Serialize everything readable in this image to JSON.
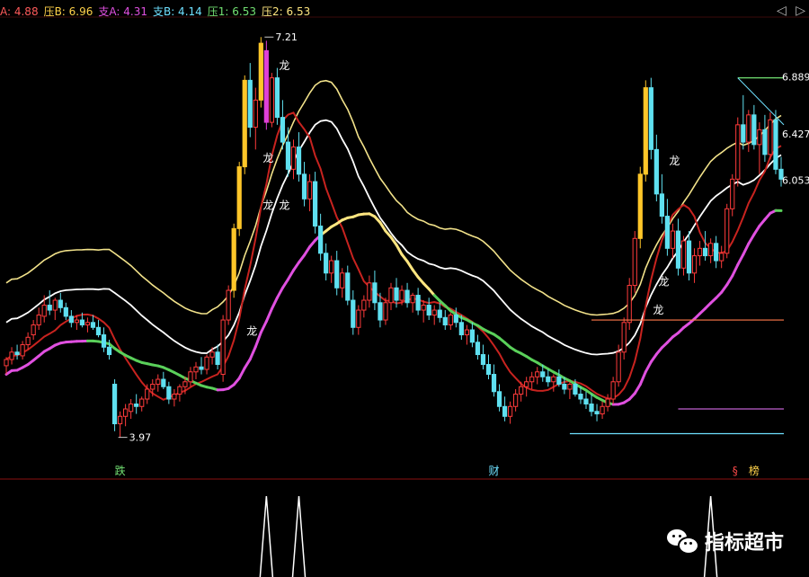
{
  "legend": [
    {
      "label": "A: 4.88",
      "color": "#ff5a5a"
    },
    {
      "label": "压B: 6.96",
      "color": "#ffd24a"
    },
    {
      "label": "支A: 4.31",
      "color": "#e050e0"
    },
    {
      "label": "支B: 4.14",
      "color": "#6ee0ff"
    },
    {
      "label": "压1: 6.53",
      "color": "#72e072"
    },
    {
      "label": "压2: 6.53",
      "color": "#ffe680"
    }
  ],
  "nav": {
    "prev": "◁",
    "next": "▷"
  },
  "watermark": {
    "text": "指标超市"
  },
  "chart_data": {
    "type": "candlestick",
    "y_range": [
      3.8,
      7.35
    ],
    "price_labels": [
      {
        "text": "7.21",
        "value": 7.21,
        "index": 48
      },
      {
        "text": "3.97",
        "value": 3.97,
        "index": 21
      },
      {
        "text": "6.889",
        "value": 6.889,
        "axis": true
      },
      {
        "text": "6.427",
        "value": 6.427,
        "axis": true
      },
      {
        "text": "6.053",
        "value": 6.053,
        "axis": true
      }
    ],
    "signal_labels": [
      {
        "text": "龙",
        "index": 50,
        "value": 6.95
      },
      {
        "text": "龙",
        "index": 47,
        "value": 6.2
      },
      {
        "text": "龙",
        "index": 47,
        "value": 5.82
      },
      {
        "text": "龙",
        "index": 50,
        "value": 5.82
      },
      {
        "text": "龙",
        "index": 44,
        "value": 4.8
      },
      {
        "text": "龙",
        "index": 122,
        "value": 6.18
      },
      {
        "text": "龙",
        "index": 120,
        "value": 5.2
      },
      {
        "text": "龙",
        "index": 119,
        "value": 4.97
      }
    ],
    "bottom_labels": [
      {
        "text": "跌",
        "index": 21,
        "color": "#72e072"
      },
      {
        "text": "财",
        "index": 90,
        "color": "#6ee0ff"
      },
      {
        "text": "§",
        "index": 135,
        "color": "#ff4a4a"
      },
      {
        "text": "榜",
        "index": 138,
        "color": "#ffd24a"
      }
    ],
    "candles": [
      [
        4.55,
        4.62,
        4.48,
        4.6
      ],
      [
        4.6,
        4.7,
        4.56,
        4.66
      ],
      [
        4.66,
        4.72,
        4.6,
        4.64
      ],
      [
        4.63,
        4.75,
        4.6,
        4.72
      ],
      [
        4.72,
        4.82,
        4.68,
        4.78
      ],
      [
        4.8,
        4.92,
        4.76,
        4.88
      ],
      [
        4.88,
        5.02,
        4.84,
        4.96
      ],
      [
        4.95,
        5.12,
        4.9,
        5.04
      ],
      [
        5.04,
        5.16,
        4.96,
        5.0
      ],
      [
        5.0,
        5.1,
        4.92,
        5.08
      ],
      [
        5.08,
        5.14,
        4.98,
        5.02
      ],
      [
        5.02,
        5.06,
        4.92,
        4.95
      ],
      [
        4.95,
        5.0,
        4.86,
        4.9
      ],
      [
        4.9,
        4.96,
        4.84,
        4.92
      ],
      [
        4.92,
        4.98,
        4.86,
        4.88
      ],
      [
        4.88,
        4.94,
        4.82,
        4.9
      ],
      [
        4.9,
        4.96,
        4.84,
        4.86
      ],
      [
        4.86,
        4.92,
        4.78,
        4.8
      ],
      [
        4.8,
        4.86,
        4.66,
        4.7
      ],
      [
        4.7,
        4.76,
        4.6,
        4.64
      ],
      [
        4.4,
        4.44,
        4.02,
        4.08
      ],
      [
        4.08,
        4.18,
        3.97,
        4.14
      ],
      [
        4.14,
        4.24,
        4.06,
        4.2
      ],
      [
        4.18,
        4.28,
        4.12,
        4.24
      ],
      [
        4.24,
        4.32,
        4.16,
        4.22
      ],
      [
        4.22,
        4.3,
        4.18,
        4.28
      ],
      [
        4.28,
        4.4,
        4.24,
        4.36
      ],
      [
        4.36,
        4.44,
        4.3,
        4.4
      ],
      [
        4.4,
        4.48,
        4.34,
        4.44
      ],
      [
        4.44,
        4.5,
        4.36,
        4.38
      ],
      [
        4.38,
        4.42,
        4.24,
        4.28
      ],
      [
        4.28,
        4.36,
        4.22,
        4.32
      ],
      [
        4.32,
        4.4,
        4.26,
        4.38
      ],
      [
        4.38,
        4.46,
        4.32,
        4.42
      ],
      [
        4.42,
        4.54,
        4.38,
        4.5
      ],
      [
        4.5,
        4.58,
        4.44,
        4.54
      ],
      [
        4.54,
        4.62,
        4.48,
        4.52
      ],
      [
        4.52,
        4.64,
        4.48,
        4.62
      ],
      [
        4.62,
        4.7,
        4.56,
        4.66
      ],
      [
        4.66,
        4.72,
        4.52,
        4.56
      ],
      [
        4.48,
        4.96,
        4.42,
        4.92
      ],
      [
        4.92,
        5.2,
        4.88,
        5.16
      ],
      [
        5.16,
        5.7,
        5.1,
        5.66
      ],
      [
        5.66,
        6.2,
        5.6,
        6.16
      ],
      [
        6.16,
        6.9,
        6.1,
        6.86
      ],
      [
        6.86,
        7.0,
        6.4,
        6.48
      ],
      [
        6.48,
        6.8,
        6.3,
        6.7
      ],
      [
        6.7,
        7.21,
        6.64,
        7.16
      ],
      [
        7.1,
        7.18,
        6.46,
        6.52
      ],
      [
        6.52,
        6.92,
        6.48,
        6.88
      ],
      [
        6.88,
        6.96,
        6.5,
        6.56
      ],
      [
        6.56,
        6.7,
        6.3,
        6.36
      ],
      [
        6.36,
        6.48,
        6.08,
        6.14
      ],
      [
        6.14,
        6.38,
        6.06,
        6.32
      ],
      [
        6.32,
        6.44,
        6.04,
        6.1
      ],
      [
        6.1,
        6.2,
        5.84,
        5.9
      ],
      [
        5.9,
        6.1,
        5.8,
        6.04
      ],
      [
        6.04,
        6.12,
        5.62,
        5.68
      ],
      [
        5.68,
        5.78,
        5.4,
        5.46
      ],
      [
        5.46,
        5.54,
        5.24,
        5.3
      ],
      [
        5.3,
        5.44,
        5.22,
        5.4
      ],
      [
        5.4,
        5.48,
        5.12,
        5.18
      ],
      [
        5.18,
        5.34,
        5.1,
        5.3
      ],
      [
        5.3,
        5.36,
        5.04,
        5.08
      ],
      [
        5.08,
        5.16,
        4.8,
        4.86
      ],
      [
        4.86,
        5.04,
        4.8,
        5.0
      ],
      [
        5.0,
        5.12,
        4.94,
        5.08
      ],
      [
        5.08,
        5.28,
        5.02,
        5.22
      ],
      [
        5.22,
        5.32,
        5.0,
        5.06
      ],
      [
        5.06,
        5.14,
        4.86,
        4.92
      ],
      [
        4.92,
        5.1,
        4.88,
        5.06
      ],
      [
        5.06,
        5.22,
        5.0,
        5.18
      ],
      [
        5.18,
        5.26,
        5.02,
        5.08
      ],
      [
        5.08,
        5.2,
        5.04,
        5.16
      ],
      [
        5.16,
        5.22,
        5.02,
        5.06
      ],
      [
        5.06,
        5.14,
        4.98,
        5.12
      ],
      [
        5.12,
        5.18,
        4.96,
        5.0
      ],
      [
        5.0,
        5.08,
        4.9,
        5.04
      ],
      [
        5.04,
        5.1,
        4.92,
        4.96
      ],
      [
        4.96,
        5.04,
        4.88,
        5.0
      ],
      [
        5.0,
        5.06,
        4.9,
        4.94
      ],
      [
        4.94,
        5.0,
        4.84,
        4.88
      ],
      [
        4.88,
        4.98,
        4.84,
        4.96
      ],
      [
        4.96,
        5.02,
        4.86,
        4.9
      ],
      [
        4.9,
        4.96,
        4.76,
        4.8
      ],
      [
        4.8,
        4.88,
        4.72,
        4.84
      ],
      [
        4.84,
        4.9,
        4.7,
        4.74
      ],
      [
        4.74,
        4.8,
        4.6,
        4.64
      ],
      [
        4.64,
        4.72,
        4.52,
        4.56
      ],
      [
        4.56,
        4.64,
        4.44,
        4.48
      ],
      [
        4.48,
        4.56,
        4.3,
        4.34
      ],
      [
        4.34,
        4.4,
        4.18,
        4.22
      ],
      [
        4.22,
        4.3,
        4.1,
        4.14
      ],
      [
        4.14,
        4.26,
        4.08,
        4.22
      ],
      [
        4.22,
        4.36,
        4.18,
        4.32
      ],
      [
        4.32,
        4.42,
        4.26,
        4.38
      ],
      [
        4.38,
        4.46,
        4.3,
        4.42
      ],
      [
        4.42,
        4.5,
        4.36,
        4.46
      ],
      [
        4.46,
        4.54,
        4.4,
        4.5
      ],
      [
        4.5,
        4.56,
        4.42,
        4.46
      ],
      [
        4.46,
        4.52,
        4.38,
        4.42
      ],
      [
        4.42,
        4.48,
        4.34,
        4.46
      ],
      [
        4.46,
        4.52,
        4.38,
        4.4
      ],
      [
        4.4,
        4.46,
        4.32,
        4.36
      ],
      [
        4.36,
        4.42,
        4.28,
        4.4
      ],
      [
        4.4,
        4.44,
        4.3,
        4.32
      ],
      [
        4.32,
        4.38,
        4.24,
        4.28
      ],
      [
        4.28,
        4.34,
        4.2,
        4.24
      ],
      [
        4.24,
        4.32,
        4.14,
        4.18
      ],
      [
        4.18,
        4.24,
        4.1,
        4.16
      ],
      [
        4.16,
        4.26,
        4.12,
        4.22
      ],
      [
        4.22,
        4.32,
        4.18,
        4.28
      ],
      [
        4.28,
        4.46,
        4.24,
        4.42
      ],
      [
        4.42,
        4.72,
        4.38,
        4.66
      ],
      [
        4.66,
        4.94,
        4.6,
        4.9
      ],
      [
        4.9,
        5.26,
        4.84,
        5.2
      ],
      [
        5.2,
        5.64,
        5.14,
        5.58
      ],
      [
        5.58,
        6.16,
        5.5,
        6.1
      ],
      [
        6.1,
        6.86,
        6.04,
        6.8
      ],
      [
        6.8,
        6.88,
        6.22,
        6.3
      ],
      [
        6.3,
        6.42,
        5.88,
        5.94
      ],
      [
        5.94,
        6.1,
        5.7,
        5.76
      ],
      [
        5.76,
        5.9,
        5.44,
        5.5
      ],
      [
        5.5,
        5.7,
        5.42,
        5.64
      ],
      [
        5.64,
        5.74,
        5.28,
        5.34
      ],
      [
        5.34,
        5.6,
        5.28,
        5.56
      ],
      [
        5.56,
        5.64,
        5.24,
        5.3
      ],
      [
        5.3,
        5.5,
        5.22,
        5.44
      ],
      [
        5.44,
        5.56,
        5.36,
        5.5
      ],
      [
        5.5,
        5.64,
        5.4,
        5.44
      ],
      [
        5.44,
        5.58,
        5.38,
        5.54
      ],
      [
        5.54,
        5.6,
        5.34,
        5.4
      ],
      [
        5.4,
        5.52,
        5.34,
        5.46
      ],
      [
        5.46,
        5.86,
        5.42,
        5.82
      ],
      [
        5.82,
        6.1,
        5.76,
        6.06
      ],
      [
        6.06,
        6.56,
        6.0,
        6.5
      ],
      [
        6.5,
        6.74,
        6.3,
        6.36
      ],
      [
        6.36,
        6.62,
        6.28,
        6.58
      ],
      [
        6.58,
        6.66,
        6.3,
        6.34
      ],
      [
        6.34,
        6.52,
        6.1,
        6.46
      ],
      [
        6.46,
        6.58,
        6.2,
        6.26
      ],
      [
        6.26,
        6.6,
        6.22,
        6.54
      ],
      [
        6.54,
        6.62,
        6.1,
        6.14
      ],
      [
        6.14,
        6.24,
        6.0,
        6.06
      ]
    ],
    "hlines": [
      {
        "name": "orange-level",
        "color": "#ff7a4a",
        "value": 4.92,
        "from": 108,
        "to": 162
      },
      {
        "name": "purple-level",
        "color": "#c060d0",
        "value": 4.2,
        "from": 124,
        "to": 162
      },
      {
        "name": "cyan-level",
        "color": "#6ee0ff",
        "value": 4.0,
        "from": 104,
        "to": 162
      },
      {
        "name": "green-level",
        "color": "#72e072",
        "value": 6.88,
        "from": 135,
        "to": 162
      }
    ],
    "oscillator_spikes": [
      48,
      54,
      130
    ],
    "oscillator_range": [
      0,
      1
    ]
  }
}
